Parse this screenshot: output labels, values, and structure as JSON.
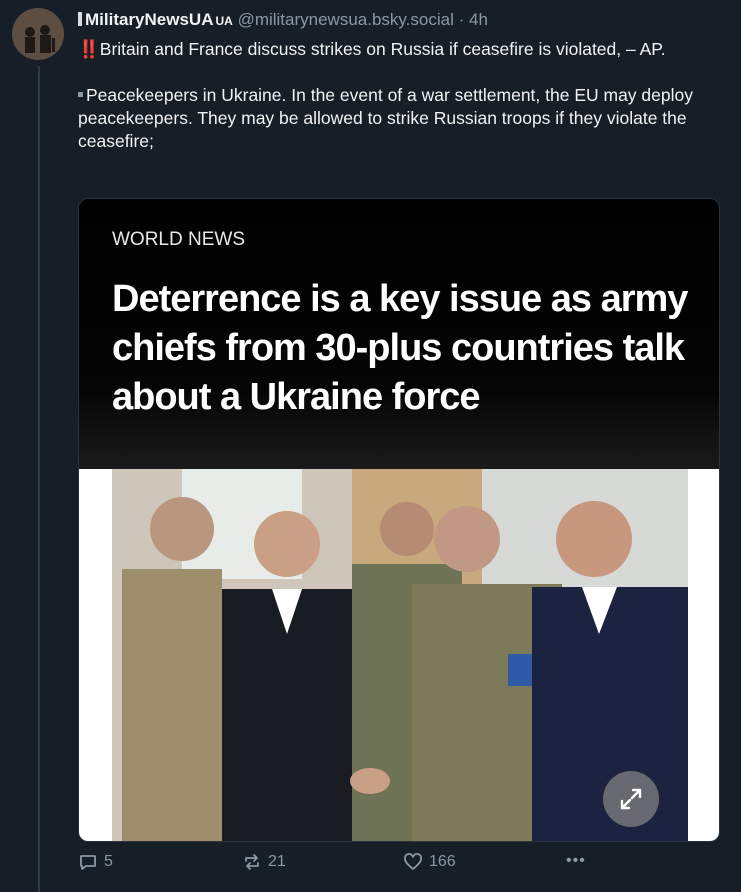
{
  "post": {
    "author_name": "MilitaryNewsUA",
    "author_suffix": "UA",
    "handle": "@militarynewsua.bsky.social",
    "separator": "·",
    "time": "4h",
    "text_line1_marker": "‼️",
    "text_line1": "Britain and France discuss strikes on Russia if ceasefire is violated, – AP.",
    "text_line2": "Peacekeepers in Ukraine. In the event of a war settlement, the EU may deploy peacekeepers. They may be allowed to strike Russian troops if they violate the ceasefire;"
  },
  "card": {
    "kicker": "WORLD NEWS",
    "headline": "Deterrence is a key issue as army chiefs from 30-plus countries talk about a Ukraine force"
  },
  "actions": {
    "replies": "5",
    "reposts": "21",
    "likes": "166",
    "more": "•••"
  },
  "colors": {
    "background": "#161e27",
    "muted": "#8b98a5",
    "accent_red": "#e0245e"
  },
  "icons": [
    "reply-icon",
    "repost-icon",
    "like-icon",
    "more-icon",
    "expand-icon"
  ]
}
